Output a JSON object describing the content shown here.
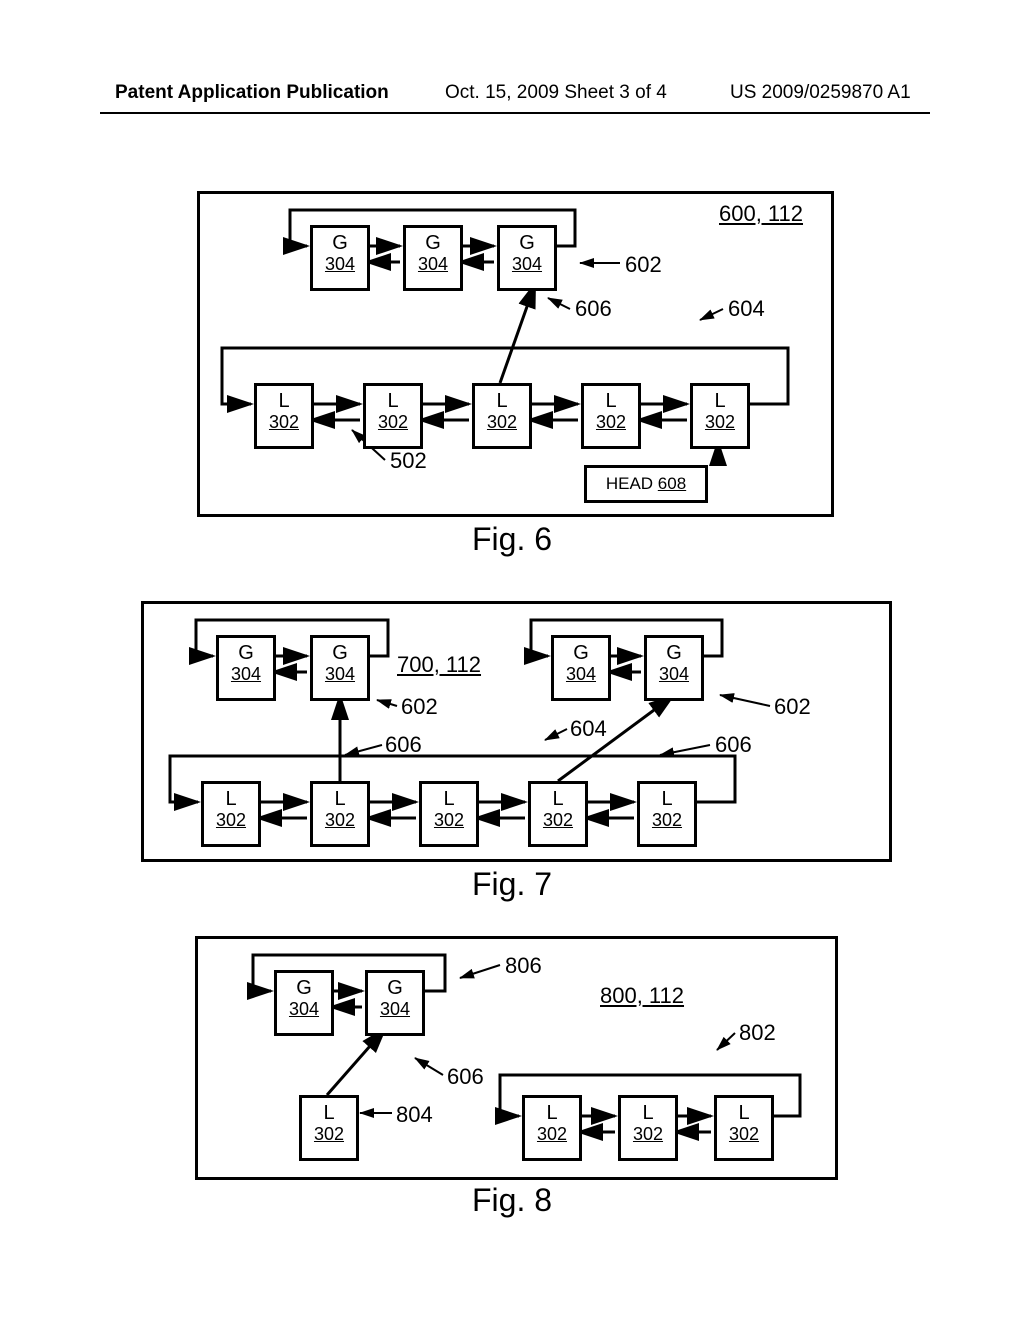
{
  "header": {
    "left": "Patent Application Publication",
    "mid": "Oct. 15, 2009  Sheet 3 of 4",
    "right": "US 2009/0259870 A1"
  },
  "figures": {
    "fig6": {
      "caption": "Fig. 6",
      "main_ref": "600, 112",
      "head": "HEAD",
      "head_ref": "608",
      "g": "G",
      "g_ref": "304",
      "l": "L",
      "l_ref": "302",
      "labels": {
        "a602": "602",
        "a604": "604",
        "a606": "606",
        "a502": "502"
      }
    },
    "fig7": {
      "caption": "Fig. 7",
      "main_ref": "700, 112",
      "g": "G",
      "g_ref": "304",
      "l": "L",
      "l_ref": "302",
      "labels": {
        "a602a": "602",
        "a602b": "602",
        "a604": "604",
        "a606a": "606",
        "a606b": "606"
      }
    },
    "fig8": {
      "caption": "Fig. 8",
      "main_ref": "800, 112",
      "g": "G",
      "g_ref": "304",
      "l": "L",
      "l_ref": "302",
      "labels": {
        "a806": "806",
        "a802": "802",
        "a606": "606",
        "a804": "804"
      }
    }
  }
}
